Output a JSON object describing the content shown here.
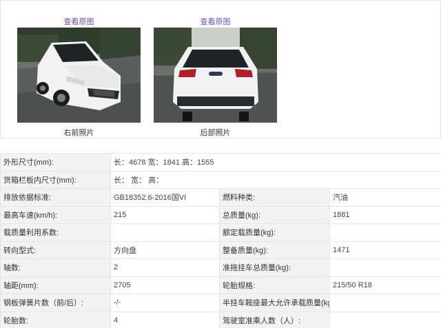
{
  "photos": {
    "view_link": "查看原图",
    "front_caption": "右前照片",
    "rear_caption": "后部照片"
  },
  "specs": {
    "dims": {
      "label": "外形尺寸(mm):",
      "value": "长：4678 宽：1841 高：1555"
    },
    "cargo": {
      "label": "货箱栏板内尺寸(mm):",
      "value": "长：  宽：  高："
    },
    "rows": [
      {
        "l1": "排放依据标准:",
        "v1": "GB18352.6-2016国VI",
        "l2": "燃料种类:",
        "v2": "汽油"
      },
      {
        "l1": "最高车速(km/h):",
        "v1": "215",
        "l2": "总质量(kg):",
        "v2": "1881"
      },
      {
        "l1": "载质量利用系数:",
        "v1": "",
        "l2": "额定载质量(kg):",
        "v2": ""
      },
      {
        "l1": "转向型式:",
        "v1": "方向盘",
        "l2": "整备质量(kg):",
        "v2": "1471"
      },
      {
        "l1": "轴数:",
        "v1": "2",
        "l2": "准拖挂车总质量(kg):",
        "v2": ""
      },
      {
        "l1": "轴距(mm):",
        "v1": "2705",
        "l2": "轮胎规格:",
        "v2": "215/50 R18"
      },
      {
        "l1": "钢板弹簧片数（前/后）:",
        "v1": "-/-",
        "l2": "半挂车鞍座最大允许承载质量(kg):",
        "v2": ""
      },
      {
        "l1": "轮胎数:",
        "v1": "4",
        "l2": "驾驶室准乘人数（人）:",
        "v2": ""
      }
    ]
  },
  "colors": {
    "car_body": "#f2f2f2",
    "link": "#6a4fa8",
    "label_bg": "#f3f3f3",
    "border": "#e4e4e4"
  },
  "icons": [
    "front-car-photo",
    "rear-car-photo"
  ]
}
